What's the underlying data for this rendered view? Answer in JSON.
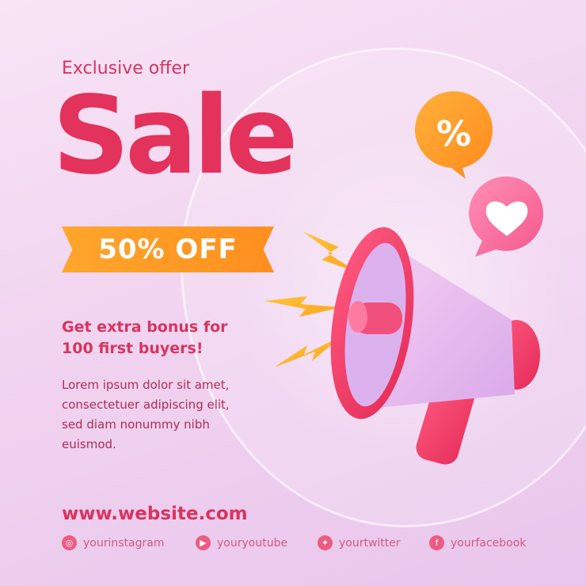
{
  "header": {
    "subtitle": "Exclusive offer",
    "title": "Sale",
    "discount": "50% OFF"
  },
  "body": {
    "bonus": "Get extra bonus for 100 first buyers!",
    "description": "Lorem ipsum dolor sit amet, consectetuer adipiscing elit, sed diam nonummy nibh euismod."
  },
  "footer": {
    "website": "www.website.com",
    "socials": [
      {
        "icon": "instagram-icon",
        "label": "yourinstagram"
      },
      {
        "icon": "youtube-icon",
        "label": "youryoutube"
      },
      {
        "icon": "twitter-icon",
        "label": "yourtwitter"
      },
      {
        "icon": "facebook-icon",
        "label": "yourfacebook"
      }
    ]
  },
  "illustration": {
    "percent_bubble_text": "%",
    "icons": [
      "megaphone-icon",
      "percent-bubble-icon",
      "heart-bubble-icon",
      "lightning-bolt-icon"
    ]
  },
  "colors": {
    "accent": "#e3325c",
    "ribbon": "#ff9a26",
    "background": "#f3d7f1"
  }
}
